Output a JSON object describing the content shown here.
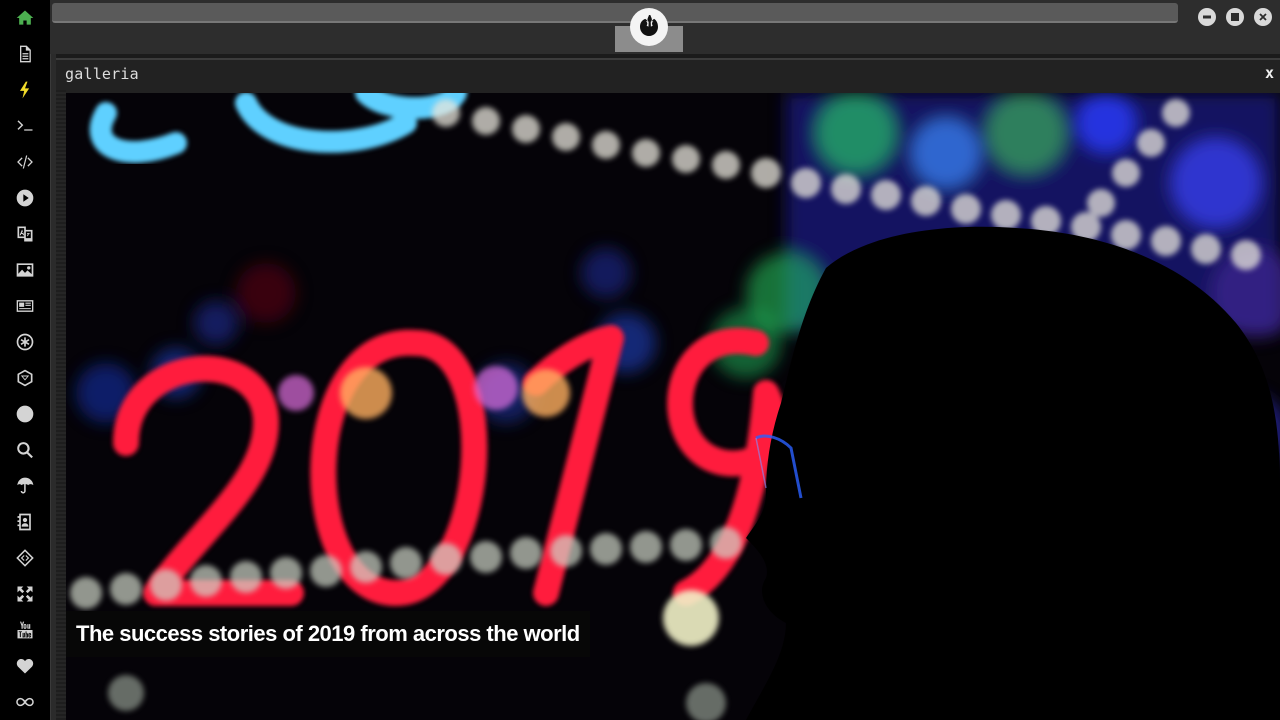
{
  "window": {
    "title": "galleria",
    "close_label": "x"
  },
  "sidebar": {
    "items": [
      {
        "icon": "home-icon"
      },
      {
        "icon": "document-icon"
      },
      {
        "icon": "lightning-icon"
      },
      {
        "icon": "terminal-icon"
      },
      {
        "icon": "code-icon"
      },
      {
        "icon": "play-icon"
      },
      {
        "icon": "translate-icon"
      },
      {
        "icon": "image-icon"
      },
      {
        "icon": "newspaper-icon"
      },
      {
        "icon": "asterisk-icon"
      },
      {
        "icon": "hexagon-icon"
      },
      {
        "icon": "globe-icon"
      },
      {
        "icon": "search-icon"
      },
      {
        "icon": "umbrella-icon"
      },
      {
        "icon": "contacts-icon"
      },
      {
        "icon": "diamond-code-icon"
      },
      {
        "icon": "expand-icon"
      },
      {
        "icon": "youtube-icon"
      },
      {
        "icon": "heart-icon"
      },
      {
        "icon": "infinity-icon"
      }
    ]
  },
  "gallery": {
    "caption": "The success stories of 2019 from across the world"
  },
  "colors": {
    "rail_bg": "#000000",
    "home_accent": "#4caf50",
    "bolt_accent": "#f2dc2a",
    "neon_red": "#ff1f3d",
    "neon_blue": "#5fd0ff"
  }
}
